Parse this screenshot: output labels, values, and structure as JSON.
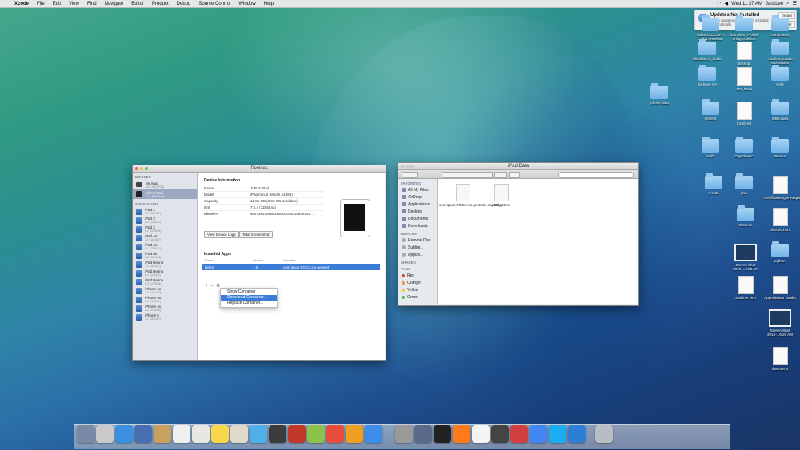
{
  "menubar": {
    "app": "Xcode",
    "menus": [
      "File",
      "Edit",
      "View",
      "Find",
      "Navigate",
      "Editor",
      "Product",
      "Debug",
      "Source Control",
      "Window",
      "Help"
    ],
    "clock": "Wed 11:37 AM",
    "user": "JackLee"
  },
  "notification": {
    "title": "Updates Not Installed",
    "subtitle": "Some updates could not be installed automatically.",
    "details": "Details",
    "install": "Install"
  },
  "devices_window": {
    "title": "Devices",
    "devices_header": "DEVICES",
    "devices": [
      {
        "name": "My Mac",
        "sub": "10.9.5 (13F34)",
        "type": "mac"
      },
      {
        "name": "John's iPad",
        "sub": "7.0.4 (11B554a)",
        "type": "ipad",
        "selected": true
      }
    ],
    "simulators_header": "SIMULATORS",
    "simulators": [
      {
        "name": "iPad 2",
        "sub": "7.1 (11D167)"
      },
      {
        "name": "iPad 2",
        "sub": "8.1 (12B411)"
      },
      {
        "name": "iPad 2",
        "sub": "8.2 (12D508)"
      },
      {
        "name": "iPad Air",
        "sub": "7.1 (11D167)"
      },
      {
        "name": "iPad Air",
        "sub": "8.1 (12B411)"
      },
      {
        "name": "iPad Air",
        "sub": "8.2 (12D508)"
      },
      {
        "name": "iPad Retina",
        "sub": "7.1 (11D167)"
      },
      {
        "name": "iPad Retina",
        "sub": "8.1 (12B411)"
      },
      {
        "name": "iPad Retina",
        "sub": "8.2 (12D508)"
      },
      {
        "name": "iPhone 4s",
        "sub": "7.1 (11D167)"
      },
      {
        "name": "iPhone 4s",
        "sub": "8.1 (12B411)"
      },
      {
        "name": "iPhone 4s",
        "sub": "8.2 (12D508)"
      },
      {
        "name": "iPhone 5",
        "sub": "7.1 (11D167)"
      }
    ],
    "info_header": "Device Information",
    "info": [
      {
        "k": "Name",
        "v": "John's iPad"
      },
      {
        "k": "Model",
        "v": "iPad mini 2 (Model A1489)"
      },
      {
        "k": "Capacity",
        "v": "12.85 GB (9.93 GB available)"
      },
      {
        "k": "iOS",
        "v": "7.0.4 (11B554a)"
      },
      {
        "k": "Identifier",
        "v": "8d47384455bb158600ca0015d4e249..."
      }
    ],
    "view_logs": "View Device Logs",
    "take_screenshot": "Take Screenshot",
    "apps_header": "Installed Apps",
    "apps_columns": [
      "Name",
      "Version",
      "Identifier"
    ],
    "apps": [
      {
        "name": "helios",
        "version": "1.0",
        "identifier": "com.ipsos.POCS.ios.geotest"
      }
    ],
    "context_menu": [
      "Show Container",
      "Download Container...",
      "Replace Container..."
    ]
  },
  "finder_window": {
    "title": "iPad Data",
    "favorites_header": "FAVORITES",
    "favorites": [
      "All My Files",
      "AirDrop",
      "Applications",
      "Desktop",
      "Documents",
      "Downloads"
    ],
    "devices_header": "DEVICES",
    "devices": [
      "Remote Disc",
      "Sublim...",
      "Appcel..."
    ],
    "shared_header": "SHARED",
    "tags_header": "TAGS",
    "tags": [
      {
        "name": "Red",
        "color": "#e0473f"
      },
      {
        "name": "Orange",
        "color": "#f39a2c"
      },
      {
        "name": "Yellow",
        "color": "#f2cf2f"
      },
      {
        "name": "Green",
        "color": "#5cb84a"
      }
    ],
    "files": [
      {
        "name": "com.ipsos.POCS.ios.geotest...cappdata"
      },
      {
        "name": ".DS_Store"
      }
    ]
  },
  "desktop_icons": [
    {
      "label": "IndirectCOGSPO CDEV...revision",
      "kind": "folder"
    },
    {
      "label": "iOSTeam_Provisi oning...ovision",
      "kind": "folder"
    },
    {
      "label": "Documents",
      "kind": "folder"
    },
    {
      "label": "distribution_bui ld",
      "kind": "folder"
    },
    {
      "label": "backup",
      "kind": "doc"
    },
    {
      "label": "Titanium Studio Workspace",
      "kind": "folder"
    },
    {
      "label": "JackLee cer",
      "kind": "folder"
    },
    {
      "label": ".DS_Store",
      "kind": "doc"
    },
    {
      "label": "work",
      "kind": "folder"
    },
    {
      "label": "iphone data",
      "kind": "folder"
    },
    {
      "label": "geotest",
      "kind": "folder"
    },
    {
      "label": "localized",
      "kind": "doc"
    },
    {
      "label": "Sites alias",
      "kind": "folder"
    },
    {
      "label": "Swift",
      "kind": "folder"
    },
    {
      "label": "Objective-C",
      "kind": "folder"
    },
    {
      "label": "iBeacon",
      "kind": "folder"
    },
    {
      "label": "e-code",
      "kind": "folder"
    },
    {
      "label": "java",
      "kind": "folder"
    },
    {
      "label": "CertificateSigninRequest",
      "kind": "doc"
    },
    {
      "label": "Titanium",
      "kind": "folder"
    },
    {
      "label": "theXML.html",
      "kind": "doc"
    },
    {
      "label": "Screen Shot 2015-...6.50 AM",
      "kind": "img"
    },
    {
      "label": "python",
      "kind": "folder"
    },
    {
      "label": "Sublime Text",
      "kind": "doc"
    },
    {
      "label": "Appcelerator Studio",
      "kind": "doc"
    },
    {
      "label": "Screen Shot 2015-...6.20 AM",
      "kind": "img"
    },
    {
      "label": "thecode.js",
      "kind": "doc"
    }
  ],
  "dock_colors": [
    "#7a8aa6",
    "#c9c9c9",
    "#3a8fe0",
    "#4a6fb0",
    "#c8a060",
    "#f0f0f0",
    "#e9e7e2",
    "#f7d84a",
    "#e0d8c8",
    "#4fb0e8",
    "#3c3c3c",
    "#c0392b",
    "#8bc34a",
    "#e74c3c",
    "#f0a020",
    "#3d8ee8",
    "#9a9a9a",
    "#5a6a88",
    "#222222",
    "#ff7a1a",
    "#f5f5f5",
    "#444444",
    "#d04040",
    "#4285f4",
    "#1aaef0",
    "#2d7fd6"
  ]
}
